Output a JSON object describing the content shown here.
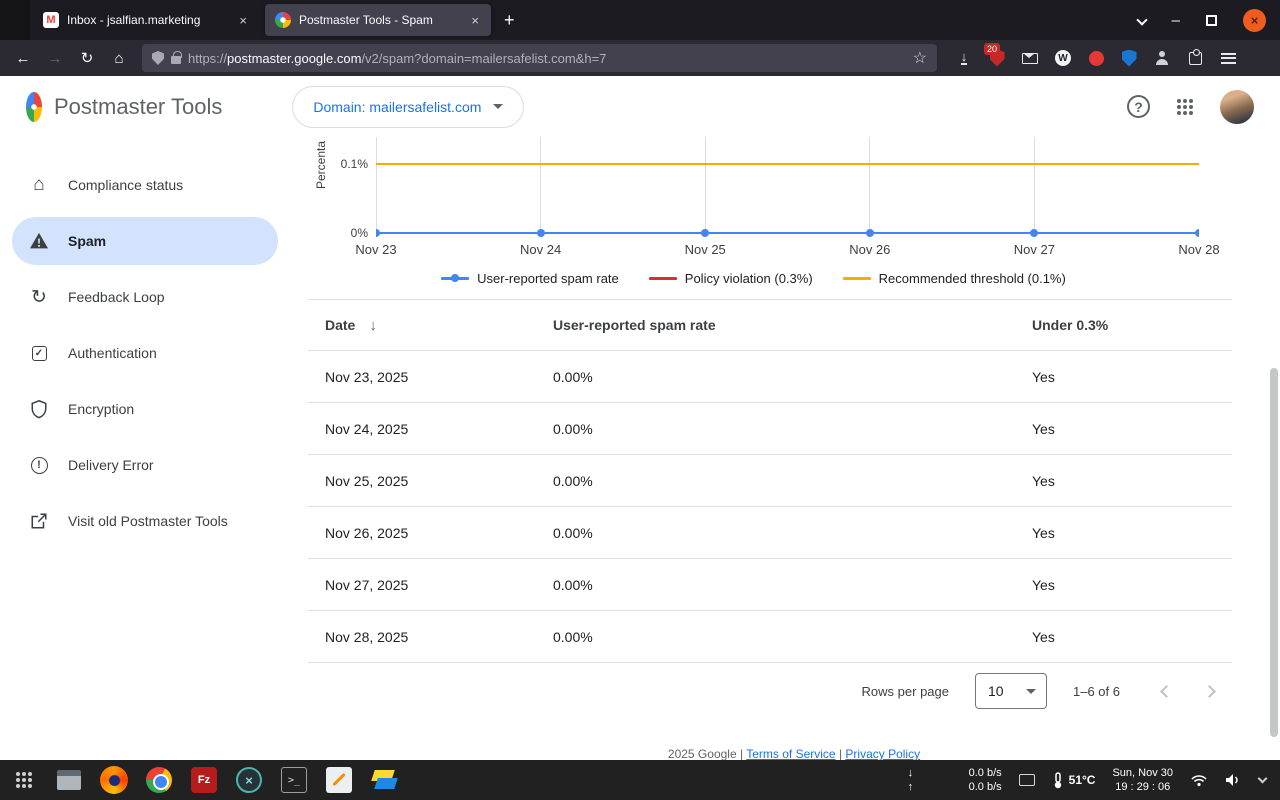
{
  "titlebar": {
    "tabs": [
      {
        "title": "Inbox - jsalfian.marketing",
        "active": false
      },
      {
        "title": "Postmaster Tools - Spam",
        "active": true
      }
    ]
  },
  "toolbar": {
    "url_scheme": "https://",
    "url_host": "postmaster.google.com",
    "url_path": "/v2/spam?domain=mailersafelist.com&h=7",
    "ext_badge": "20"
  },
  "header": {
    "app_title": "Postmaster Tools",
    "domain_button": "Domain: mailersafelist.com"
  },
  "sidebar": {
    "items": [
      {
        "label": "Compliance status",
        "icon": "home-icon",
        "active": false
      },
      {
        "label": "Spam",
        "icon": "warning-triangle-icon",
        "active": true
      },
      {
        "label": "Feedback Loop",
        "icon": "loop-icon",
        "active": false
      },
      {
        "label": "Authentication",
        "icon": "check-box-icon",
        "active": false
      },
      {
        "label": "Encryption",
        "icon": "shield-icon",
        "active": false
      },
      {
        "label": "Delivery Error",
        "icon": "error-circle-icon",
        "active": false
      },
      {
        "label": "Visit old Postmaster Tools",
        "icon": "external-link-icon",
        "active": false
      }
    ]
  },
  "chart_data": {
    "type": "line",
    "x": [
      "Nov 23",
      "Nov 24",
      "Nov 25",
      "Nov 26",
      "Nov 27",
      "Nov 28"
    ],
    "series": [
      {
        "name": "User-reported spam rate",
        "values": [
          0,
          0,
          0,
          0,
          0,
          0
        ],
        "color": "#4285f4",
        "markers": true
      },
      {
        "name": "Policy violation (0.3%)",
        "values": [
          0.3,
          0.3,
          0.3,
          0.3,
          0.3,
          0.3
        ],
        "color": "#d93025",
        "markers": false
      },
      {
        "name": "Recommended threshold (0.1%)",
        "values": [
          0.1,
          0.1,
          0.1,
          0.1,
          0.1,
          0.1
        ],
        "color": "#f9ab00",
        "markers": false
      }
    ],
    "ylabel": "Percenta",
    "yticks": [
      "0.1%",
      "0%"
    ],
    "grid": true,
    "legend_position": "bottom"
  },
  "table": {
    "columns": [
      "Date",
      "User-reported spam rate",
      "Under 0.3%"
    ],
    "rows": [
      {
        "date": "Nov 23, 2025",
        "rate": "0.00%",
        "under": "Yes"
      },
      {
        "date": "Nov 24, 2025",
        "rate": "0.00%",
        "under": "Yes"
      },
      {
        "date": "Nov 25, 2025",
        "rate": "0.00%",
        "under": "Yes"
      },
      {
        "date": "Nov 26, 2025",
        "rate": "0.00%",
        "under": "Yes"
      },
      {
        "date": "Nov 27, 2025",
        "rate": "0.00%",
        "under": "Yes"
      },
      {
        "date": "Nov 28, 2025",
        "rate": "0.00%",
        "under": "Yes"
      }
    ],
    "pagination": {
      "rows_per_page_label": "Rows per page",
      "rows_per_page_value": "10",
      "range": "1–6 of 6"
    }
  },
  "page_footer": {
    "text": "2025 Google",
    "separator": "|",
    "links": [
      "Terms of Service",
      "Privacy Policy"
    ]
  },
  "taskbar": {
    "net_down": "0.0 b/s",
    "net_up": "0.0 b/s",
    "temperature": "51°C",
    "date": "Sun, Nov 30",
    "time": "19 : 29 : 06"
  },
  "colors": {
    "accent_blue": "#1a73e8",
    "chart_blue": "#4285f4",
    "chart_red": "#d93025",
    "chart_orange": "#f9ab00",
    "sidebar_active_bg": "#d3e3fd"
  }
}
